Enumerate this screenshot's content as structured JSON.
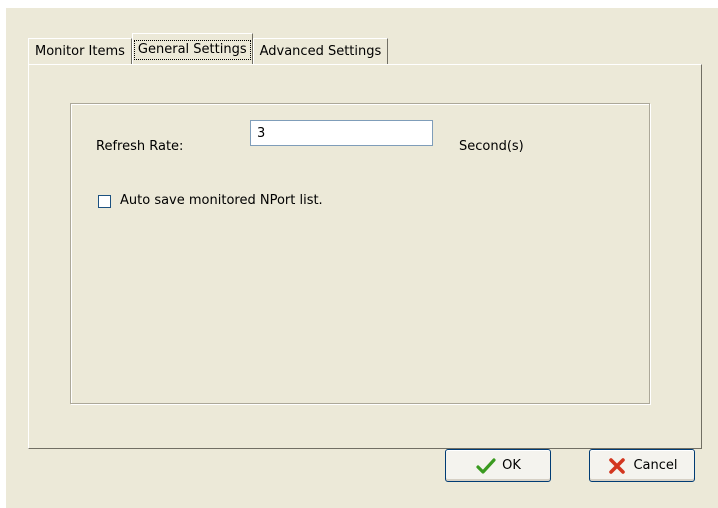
{
  "tabs": [
    {
      "label": "Monitor Items"
    },
    {
      "label": "General Settings"
    },
    {
      "label": "Advanced Settings"
    }
  ],
  "active_tab": "General Settings",
  "general_settings": {
    "refresh_rate_label": "Refresh Rate:",
    "refresh_rate_value": "3",
    "refresh_rate_unit": "Second(s)",
    "auto_save_label": "Auto save monitored NPort list.",
    "auto_save_checked": false
  },
  "buttons": {
    "ok_label": "OK",
    "ok_icon": "check-icon",
    "cancel_label": "Cancel",
    "cancel_icon": "x-icon"
  },
  "colors": {
    "dialog_background": "#ece9d8",
    "ok_icon_green": "#3a9a1f",
    "cancel_icon_red": "#d3361f"
  }
}
